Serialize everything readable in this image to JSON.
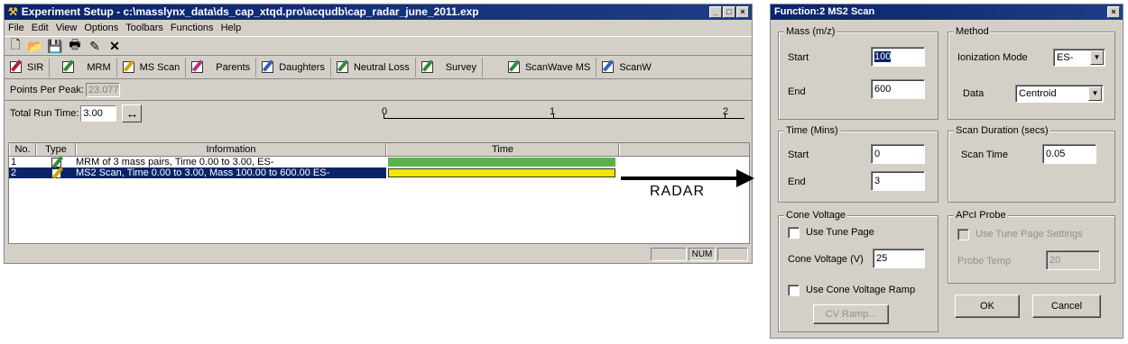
{
  "main_window": {
    "title": "Experiment Setup - c:\\masslynx_data\\ds_cap_xtqd.pro\\acqudb\\cap_radar_june_2011.exp",
    "menu": [
      "File",
      "Edit",
      "View",
      "Options",
      "Toolbars",
      "Functions",
      "Help"
    ],
    "toolbar_icons": [
      "new-icon",
      "open-icon",
      "save-icon",
      "print-icon",
      "edit-icon",
      "delete-icon"
    ],
    "function_buttons": [
      {
        "label": "SIR",
        "color": "red"
      },
      {
        "label": "MRM",
        "color": "green"
      },
      {
        "label": "MS Scan",
        "color": "yellow"
      },
      {
        "label": "Parents",
        "color": "magenta"
      },
      {
        "label": "Daughters",
        "color": "blue"
      },
      {
        "label": "Neutral Loss",
        "color": "green"
      },
      {
        "label": "Survey",
        "color": "green"
      },
      {
        "label": "ScanWave MS",
        "color": "green"
      },
      {
        "label": "ScanW",
        "color": "blue"
      }
    ],
    "points_per_peak_label": "Points Per Peak:",
    "points_per_peak_value": "23.077",
    "total_run_time_label": "Total Run Time:",
    "total_run_time_value": "3.00",
    "time_ticks": [
      "0",
      "1",
      "2"
    ],
    "table": {
      "headers": {
        "no": "No.",
        "type": "Type",
        "info": "Information",
        "time": "Time"
      },
      "rows": [
        {
          "no": "1",
          "info": "MRM of 3 mass pairs, Time 0.00 to 3.00, ES-",
          "bar_color": "#5cb24a"
        },
        {
          "no": "2",
          "info": "MS2 Scan, Time 0.00 to 3.00, Mass 100.00 to 600.00 ES-",
          "bar_color": "#f2e600"
        }
      ]
    },
    "status_num": "NUM"
  },
  "annotation": {
    "label": "RADAR"
  },
  "dialog": {
    "title": "Function:2 MS2 Scan",
    "mass": {
      "group": "Mass (m/z)",
      "start_label": "Start",
      "start_value": "100",
      "end_label": "End",
      "end_value": "600"
    },
    "method": {
      "group": "Method",
      "ionization_label": "Ionization Mode",
      "ionization_value": "ES-",
      "data_label": "Data",
      "data_value": "Centroid"
    },
    "time": {
      "group": "Time (Mins)",
      "start_label": "Start",
      "start_value": "0",
      "end_label": "End",
      "end_value": "3"
    },
    "scan_duration": {
      "group": "Scan Duration (secs)",
      "scan_time_label": "Scan Time",
      "scan_time_value": "0.05"
    },
    "cone": {
      "group": "Cone Voltage",
      "use_tune_label": "Use Tune Page",
      "voltage_label": "Cone Voltage (V)",
      "voltage_value": "25",
      "ramp_label": "Use Cone Voltage Ramp",
      "cv_ramp_button": "CV Ramp..."
    },
    "apci": {
      "group": "APcI Probe",
      "use_tune_label": "Use Tune Page Settings",
      "probe_temp_label": "Probe Temp",
      "probe_temp_value": "20"
    },
    "ok_label": "OK",
    "cancel_label": "Cancel"
  }
}
